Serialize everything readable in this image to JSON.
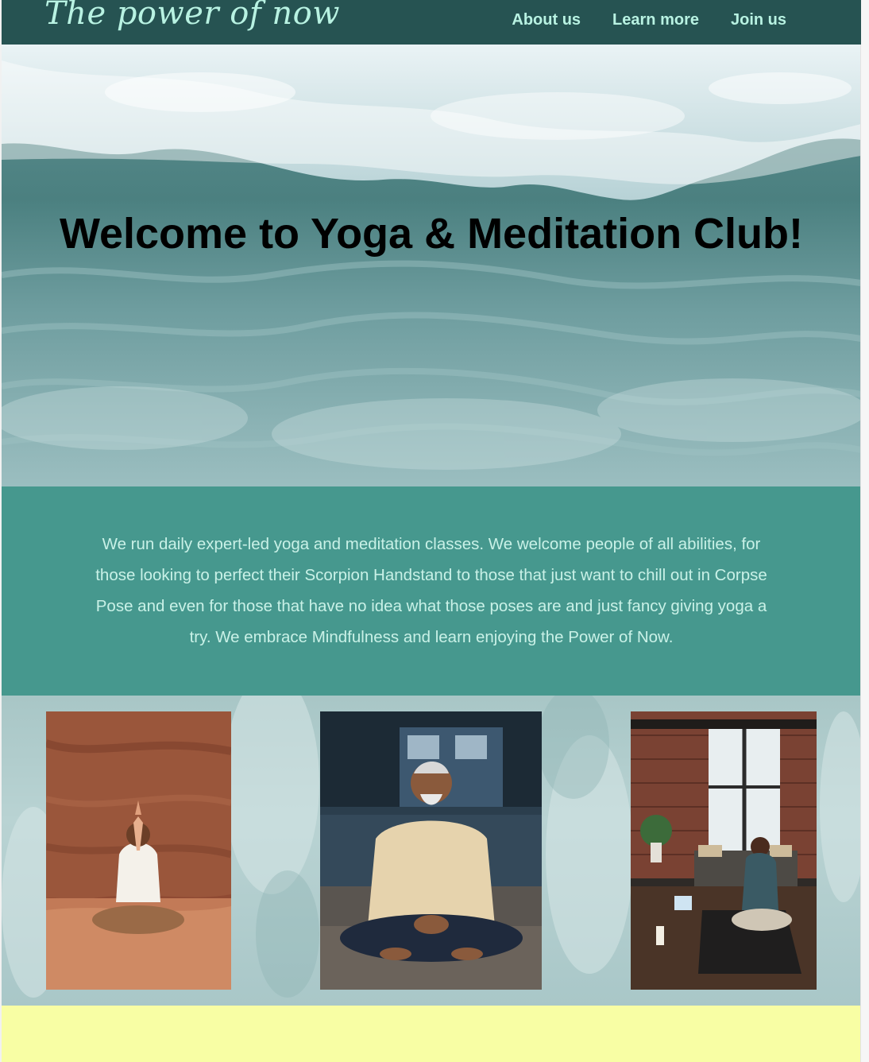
{
  "navbar": {
    "brand": "The power of now",
    "links": [
      {
        "label": "About us"
      },
      {
        "label": "Learn more"
      },
      {
        "label": "Join us"
      }
    ]
  },
  "hero": {
    "title": "Welcome to Yoga & Meditation Club!",
    "background": "ocean-waves-aerial"
  },
  "about": {
    "text": "We run daily expert-led yoga and meditation classes. We welcome people of all abilities, for those looking to perfect their Scorpion Handstand to those that just want to chill out in Corpse Pose and even for those that have no idea what those poses are and just fancy giving yoga a try. We embrace Mindfulness and learn enjoying the Power of Now."
  },
  "gallery": {
    "photos": [
      {
        "subject": "woman meditating on desert sand"
      },
      {
        "subject": "elderly man meditating cross-legged"
      },
      {
        "subject": "man meditating on mat in loft"
      }
    ]
  },
  "colors": {
    "navbar_bg": "#265352",
    "nav_text": "#b8f2e2",
    "about_bg": "#46988e",
    "about_text": "#c9f1e7",
    "footer_bg": "#f8fea4"
  }
}
